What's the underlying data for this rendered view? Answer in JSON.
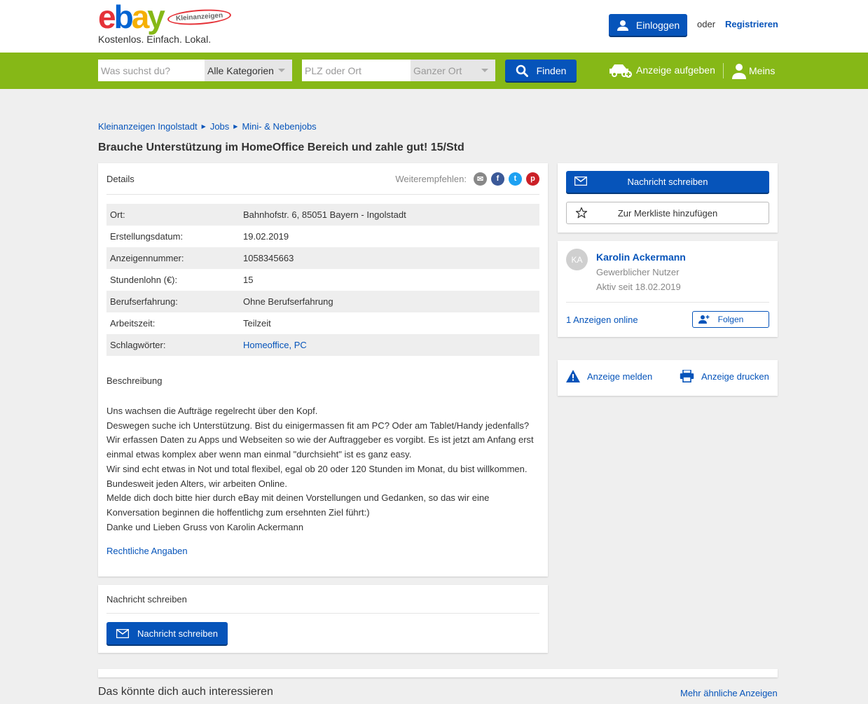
{
  "header": {
    "logo_letters": [
      "e",
      "b",
      "a",
      "y"
    ],
    "logo_badge": "Kleinanzeigen",
    "tagline": "Kostenlos. Einfach. Lokal.",
    "login_label": "Einloggen",
    "or_label": "oder",
    "register_label": "Registrieren"
  },
  "search": {
    "query_placeholder": "Was suchst du?",
    "category_selected": "Alle Kategorien",
    "location_placeholder": "PLZ oder Ort",
    "radius_selected": "Ganzer Ort",
    "find_label": "Finden",
    "post_ad_label": "Anzeige aufgeben",
    "meins_label": "Meins"
  },
  "breadcrumb": [
    "Kleinanzeigen Ingolstadt",
    "Jobs",
    "Mini- & Nebenjobs"
  ],
  "title": "Brauche Unterstützung im HomeOffice Bereich und zahle gut! 15/Std",
  "details": {
    "header": "Details",
    "share_label": "Weiterempfehlen:",
    "share_icons": [
      {
        "name": "email-share-icon",
        "glyph": "✉",
        "color": "#888888"
      },
      {
        "name": "facebook-share-icon",
        "glyph": "f",
        "color": "#3b5998"
      },
      {
        "name": "twitter-share-icon",
        "glyph": "t",
        "color": "#1da1f2"
      },
      {
        "name": "pinterest-share-icon",
        "glyph": "p",
        "color": "#cb2027"
      }
    ],
    "attributes": [
      {
        "key": "Ort:",
        "value": "Bahnhofstr. 6, 85051 Bayern - Ingolstadt"
      },
      {
        "key": "Erstellungsdatum:",
        "value": "19.02.2019"
      },
      {
        "key": "Anzeigennummer:",
        "value": "1058345663"
      },
      {
        "key": "Stundenlohn (€):",
        "value": "15"
      },
      {
        "key": "Berufserfahrung:",
        "value": "Ohne Berufserfahrung"
      },
      {
        "key": "Arbeitszeit:",
        "value": "Teilzeit"
      },
      {
        "key": "Schlagwörter:",
        "value": "Homeoffice, PC"
      }
    ],
    "description_title": "Beschreibung",
    "description_lines": [
      "Uns wachsen die Aufträge regelrecht über den Kopf.",
      "Deswegen suche ich Unterstützung. Bist du einigermassen fit am PC? Oder am Tablet/Handy jedenfalls?",
      "Wir erfassen Daten zu Apps und Webseiten so wie der Auftraggeber es vorgibt. Es ist jetzt am Anfang erst einmal etwas komplex aber wenn man einmal \"durchsieht\" ist es ganz easy.",
      "Wir sind echt etwas in Not und total flexibel, egal ob 20 oder 120 Stunden im Monat, du bist willkommen.",
      "Bundesweit jeden Alters, wir arbeiten Online.",
      "Melde dich doch bitte hier durch eBay mit deinen Vorstellungen und Gedanken, so das wir eine Konversation beginnen die hoffentlichg zum ersehnten Ziel führt:)",
      "Danke und Lieben Gruss von Karolin Ackermann"
    ],
    "legal_link": "Rechtliche Angaben"
  },
  "message_box": {
    "header": "Nachricht schreiben",
    "button_label": "Nachricht schreiben"
  },
  "actions": {
    "message_label": "Nachricht schreiben",
    "watchlist_label": "Zur Merkliste hinzufügen"
  },
  "seller": {
    "initials": "KA",
    "name": "Karolin Ackermann",
    "type": "Gewerblicher Nutzer",
    "since": "Aktiv seit 18.02.2019",
    "ads_online": "1 Anzeigen online",
    "follow_label": "Folgen"
  },
  "report": {
    "report_label": "Anzeige melden",
    "print_label": "Anzeige drucken"
  },
  "more": {
    "title": "Das könnte dich auch interessieren",
    "link": "Mehr ähnliche Anzeigen"
  },
  "colors": {
    "brand_blue": "#0654ba",
    "brand_green": "#86b817"
  }
}
